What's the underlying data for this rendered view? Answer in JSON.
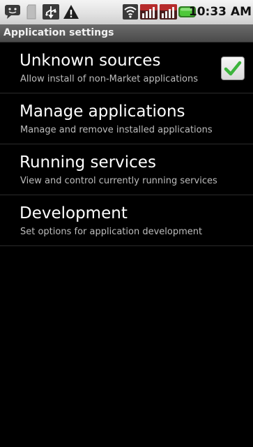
{
  "status_bar": {
    "icons": [
      "talk-icon",
      "sd-card-icon",
      "usb-debug-icon",
      "warning-icon",
      "wifi-icon",
      "signal-icon",
      "signal-icon",
      "battery-icon"
    ],
    "time": "10:33 AM",
    "colors": {
      "background": "#e2e2e2",
      "battery": "#4fc83a"
    }
  },
  "title_bar": {
    "title": "Application settings"
  },
  "preferences": [
    {
      "title": "Unknown sources",
      "summary": "Allow install of non-Market applications",
      "checked": true
    },
    {
      "title": "Manage applications",
      "summary": "Manage and remove installed applications"
    },
    {
      "title": "Running services",
      "summary": "View and control currently running services"
    },
    {
      "title": "Development",
      "summary": "Set options for application development"
    }
  ],
  "colors": {
    "background": "#000000",
    "title_text": "#ffffff",
    "summary_text": "#bdbdbd",
    "checkmark": "#3cb43c"
  }
}
